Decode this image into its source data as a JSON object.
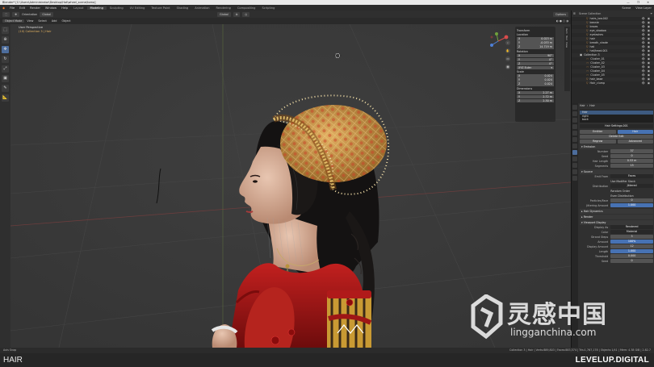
{
  "window": {
    "title": "Blender* [C:\\Users\\Administrator\\Desktop\\Hat\\wheel_scene\\tomo]",
    "controls": "—  ❐  ✕"
  },
  "menubar": {
    "menus": [
      "File",
      "Edit",
      "Render",
      "Window",
      "Help"
    ],
    "workspaces": [
      "Layout",
      "Modeling",
      "Sculpting",
      "UV Editing",
      "Texture Paint",
      "Shading",
      "Animation",
      "Rendering",
      "Compositing",
      "Scripting"
    ],
    "active_workspace": "Modeling",
    "scene": "Scene",
    "view_layer": "View Layer"
  },
  "header": {
    "orientation_label": "Orientation",
    "orientation_value": "Global",
    "transform_space": "Global",
    "options": "Options",
    "mode": "Object Mode",
    "menus": [
      "View",
      "Select",
      "Add",
      "Object"
    ]
  },
  "viewport": {
    "view_name": "User Perspective",
    "collection": "(10) Collection 3 | Hair"
  },
  "npanel": {
    "tabs": [
      "Item",
      "Tool",
      "View"
    ],
    "title": "Transform",
    "location_label": "Location",
    "location": [
      [
        "X",
        "0.023 m"
      ],
      [
        "Y",
        "-0.033 m"
      ],
      [
        "Z",
        "14.719 m"
      ]
    ],
    "rotation_label": "Rotation",
    "rotation": [
      [
        "X",
        "90°"
      ],
      [
        "Y",
        "0°"
      ],
      [
        "Z",
        "0°"
      ]
    ],
    "mode_label": "XYZ Euler",
    "scale_label": "Scale",
    "scale": [
      [
        "X",
        "0.024"
      ],
      [
        "Y",
        "0.024"
      ],
      [
        "Z",
        "0.024"
      ]
    ],
    "dimensions_label": "Dimensions",
    "dimensions": [
      [
        "X",
        "2.27 m"
      ],
      [
        "Y",
        "2.72 m"
      ],
      [
        "Z",
        "2.30 m"
      ]
    ]
  },
  "outliner": {
    "header": "Scene Collection",
    "items": [
      "hairs_low.002",
      "beanie",
      "brows",
      "eye_shadow",
      "eyelashes",
      "hair",
      "breath_shade",
      "hat",
      "hat/head.001",
      "Collection 3",
      "Cluster_01",
      "Cluster_02",
      "Cluster_03",
      "Cluster_04",
      "Cluster_05",
      "hair_base",
      "Hair_clump"
    ]
  },
  "properties": {
    "object": "Hair",
    "modifier": "Hair",
    "systems": [
      "Hair",
      "right",
      "back"
    ],
    "settings_name": "Hair Settings.001",
    "type_options": [
      "Emitter",
      "Hair"
    ],
    "delete_edit": "Delete Edit",
    "hair_toggles": [
      "Regrow",
      "Advanced"
    ],
    "sections": {
      "emission": "Emission",
      "source": "Source",
      "hair_dynamics": "Hair Dynamics",
      "render": "Render",
      "viewport_display": "Viewport Display"
    },
    "emission": [
      [
        "Number",
        "37"
      ],
      [
        "Seed",
        "0"
      ],
      [
        "Hair Length",
        "0.53 m"
      ],
      [
        "Segments",
        "15"
      ]
    ],
    "source": [
      [
        "Emit From",
        "Faces"
      ],
      [
        "",
        "Use Modifier Stack"
      ],
      [
        "Distribution",
        "Jittered"
      ],
      [
        "",
        "Random Order"
      ],
      [
        "",
        "Even Distribution"
      ],
      [
        "Particles/Face",
        "0"
      ],
      [
        "Jittering Amount",
        "1.000"
      ]
    ],
    "display": [
      [
        "Display As",
        "Rendered"
      ],
      [
        "Color",
        "Material"
      ],
      [
        "Strand Steps",
        "3"
      ],
      [
        "Amount",
        "100%"
      ],
      [
        "Display Amount",
        "12"
      ],
      [
        "Length",
        "1.000"
      ],
      [
        "Threshold",
        "0.000"
      ],
      [
        "Seed",
        "0"
      ]
    ]
  },
  "status": {
    "left": "Axis Snap",
    "right": "Collection 3 | Hair | Verts:889,803 | Faces:883,574 | Tris:1,767,178 | Objects:1/41 | Mem: 4.38 GiB | 2.82.7"
  },
  "bottom": {
    "course_label": "HAIR",
    "brand": "LEVELUP.DIGITAL"
  },
  "watermark": {
    "chinese": "灵感中国",
    "url": "lingganchina.com"
  },
  "colors": {
    "accent": "#4772b3",
    "orange": "#e39b46",
    "viewport_bg": "#393939"
  }
}
